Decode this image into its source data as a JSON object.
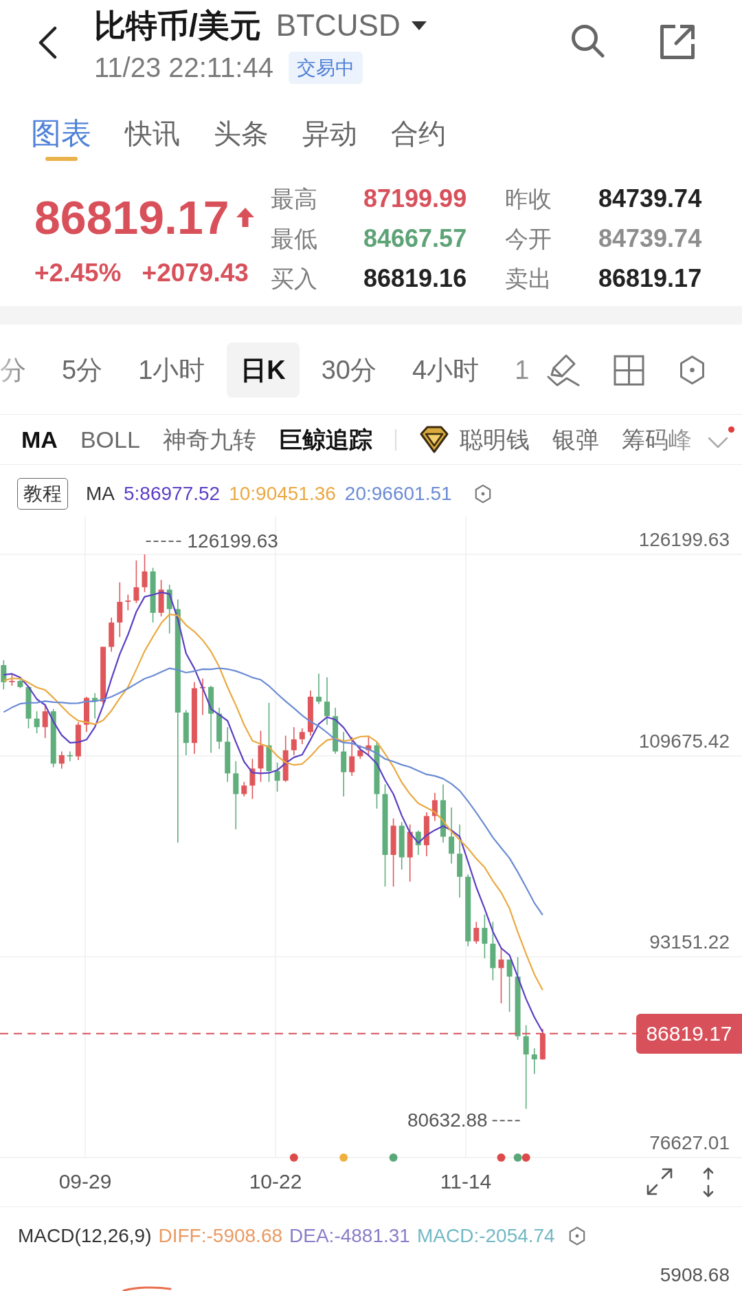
{
  "header": {
    "title": "比特币/美元",
    "symbol": "BTCUSD",
    "time": "11/23 22:11:44",
    "status": "交易中"
  },
  "tabs": [
    {
      "label": "图表",
      "selected": true
    },
    {
      "label": "快讯",
      "selected": false
    },
    {
      "label": "头条",
      "selected": false
    },
    {
      "label": "异动",
      "selected": false
    },
    {
      "label": "合约",
      "selected": false
    }
  ],
  "quote": {
    "price": "86819.17",
    "rising": true,
    "change_percent": "+2.45%",
    "change": "+2079.43",
    "stats": [
      {
        "label": "最高",
        "value": "87199.99",
        "color": "#d8505a"
      },
      {
        "label": "昨收",
        "value": "84739.74",
        "color": "#222222"
      },
      {
        "label": "最低",
        "value": "84667.57",
        "color": "#5ea377"
      },
      {
        "label": "今开",
        "value": "84739.74",
        "color": "#8d8d8d"
      },
      {
        "label": "买入",
        "value": "86819.16",
        "color": "#222222"
      },
      {
        "label": "卖出",
        "value": "86819.17",
        "color": "#222222"
      }
    ]
  },
  "intervals": [
    {
      "label": "分",
      "selected": false
    },
    {
      "label": "5分",
      "selected": false
    },
    {
      "label": "1小时",
      "selected": false
    },
    {
      "label": "日K",
      "selected": true
    },
    {
      "label": "30分",
      "selected": false
    },
    {
      "label": "4小时",
      "selected": false
    },
    {
      "label": "1",
      "selected": false
    }
  ],
  "indicators": [
    {
      "label": "MA",
      "selected": true
    },
    {
      "label": "BOLL",
      "selected": false
    },
    {
      "label": "神奇九转",
      "selected": false
    },
    {
      "label": "巨鲸追踪",
      "selected": true
    }
  ],
  "premium_indicators": [
    {
      "label": "聪明钱",
      "selected": false
    },
    {
      "label": "银弹",
      "selected": false
    },
    {
      "label": "筹码峰",
      "selected": false
    }
  ],
  "indicator_menu": {
    "new_dot": true
  },
  "chart": {
    "tutorial_button": "教程",
    "ma_legend": {
      "label": "MA",
      "items": [
        {
          "text": "5:86977.52",
          "color": "#5b3fc4"
        },
        {
          "text": "10:90451.36",
          "color": "#eaa941"
        },
        {
          "text": "20:96601.51",
          "color": "#6a8bd4"
        }
      ]
    },
    "price_axis": [
      "126199.63",
      "109675.42",
      "93151.22",
      "76627.01"
    ],
    "high_label": "126199.63",
    "low_label": "80632.88",
    "current_price_tag": "86819.17",
    "signal_markers": [
      {
        "color": "#dc4a4a"
      },
      {
        "color": "#eeb13e"
      },
      {
        "color": "#58a878"
      },
      {
        "color": "#dc4a4a"
      },
      {
        "color": "#58a878"
      },
      {
        "color": "#dc4a4a"
      }
    ],
    "date_axis": [
      "09-29",
      "10-22",
      "11-14"
    ]
  },
  "macd": {
    "label": "MACD(12,26,9)",
    "values": [
      {
        "text": "DIFF:-5908.68",
        "color": "#e99a62"
      },
      {
        "text": "DEA:-4881.31",
        "color": "#8a7cc8"
      },
      {
        "text": "MACD:-2054.74",
        "color": "#72b8c4"
      }
    ],
    "axis_label": "5908.68"
  }
}
